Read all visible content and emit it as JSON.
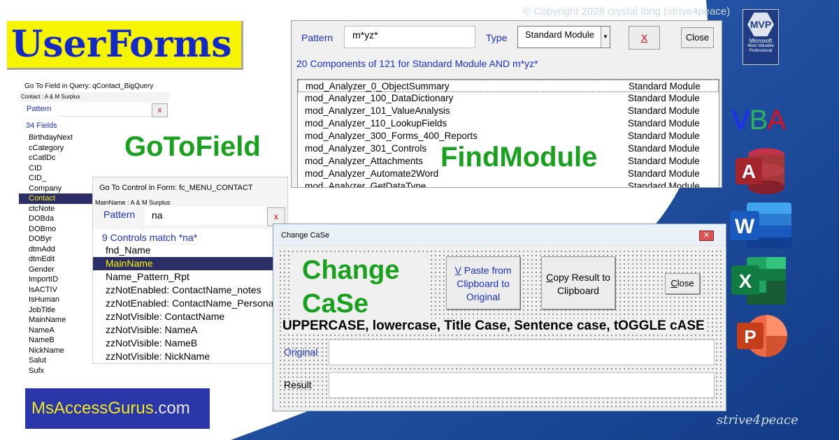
{
  "banner": {
    "title": "UserForms"
  },
  "copyright": "© Copyright 2026 crystal long (strive4peace)",
  "mvp": {
    "label": "MVP",
    "line1": "Microsoft",
    "line2": "Most Valuable",
    "line3": "Professional"
  },
  "vba": {
    "v": "V",
    "b": "B",
    "a": "A"
  },
  "labels": {
    "gotofield": "GoToField",
    "findmodule": "FindModule"
  },
  "goto_field": {
    "header": "Go To Field in Query: qContact_BigQuery",
    "subheader": "Contact : A & M Surplus",
    "pattern_label": "Pattern",
    "pattern_value": "",
    "clear_label": "x",
    "count": "34 Fields",
    "fields": [
      "BirthdayNext",
      "cCategory",
      "cCatlDc",
      "CID",
      "CID_",
      "Company",
      "Contact",
      "ctcNote",
      "DOBda",
      "DOBmo",
      "DOByr",
      "dtmAdd",
      "dtmEdit",
      "Gender",
      "ImportID",
      "IsACTIV",
      "IsHuman",
      "JobTitle",
      "MainName",
      "NameA",
      "NameB",
      "NickName",
      "Salut",
      "Sufx"
    ],
    "selected": "Contact"
  },
  "goto_control": {
    "header": "Go To Control in Form: fc_MENU_CONTACT",
    "subheader": "MainName : A & M Surplus",
    "pattern_label": "Pattern",
    "pattern_value": "na",
    "clear_label": "x",
    "count": "9 Controls match *na*",
    "controls": [
      "fnd_Name",
      "MainName",
      "Name_Pattern_Rpt",
      "zzNotEnabled: ContactName_notes",
      "zzNotEnabled: ContactName_Personal",
      "zzNotVisible: ContactName",
      "zzNotVisible: NameA",
      "zzNotVisible: NameB",
      "zzNotVisible: NickName"
    ],
    "selected": "MainName"
  },
  "find_module": {
    "pattern_label": "Pattern",
    "pattern_value": "m*yz*",
    "type_label": "Type",
    "type_value": "Standard Module",
    "clear_label": "X",
    "close_label": "Close",
    "count": "20 Components of 121 for Standard Module AND m*yz*",
    "rows": [
      {
        "name": "mod_Analyzer_0_ObjectSummary",
        "type": "Standard Module"
      },
      {
        "name": "mod_Analyzer_100_DataDictionary",
        "type": "Standard Module"
      },
      {
        "name": "mod_Analyzer_101_ValueAnalysis",
        "type": "Standard Module"
      },
      {
        "name": "mod_Analyzer_110_LookupFields",
        "type": "Standard Module"
      },
      {
        "name": "mod_Analyzer_300_Forms_400_Reports",
        "type": "Standard Module"
      },
      {
        "name": "mod_Analyzer_301_Controls",
        "type": "Standard Module"
      },
      {
        "name": "mod_Analyzer_Attachments",
        "type": "Standard Module"
      },
      {
        "name": "mod_Analyzer_Automate2Word",
        "type": "Standard Module"
      },
      {
        "name": "mod_Analyzer_GetDataType",
        "type": "Standard Module"
      }
    ]
  },
  "change_case": {
    "window_title": "Change CaSe",
    "close_x": "✕",
    "big_title": "Change\nCaSe",
    "paste_button": "V Paste from Clipboard to Original",
    "paste_hotkey": "V",
    "paste_rest": " Paste from Clipboard to Original",
    "copy_button": "Copy Result to Clipboard",
    "copy_hotkey": "C",
    "copy_rest": "opy Result to Clipboard",
    "close_button": "Close",
    "close_hotkey": "C",
    "close_rest": "lose",
    "modes": "UPPERCASE, lowercase, Title Case, Sentence case, tOGGLE cASE",
    "original_label": "Original",
    "original_value": "",
    "result_label": "Result",
    "result_value": ""
  },
  "logo": {
    "part1": "MsAccessGurus",
    "part2": ".com"
  },
  "signature": "strive4peace",
  "colors": {
    "accent_blue": "#1a2fd0",
    "green": "#17a11c",
    "banner_yellow": "#f7f400",
    "selection": "#2b2e67"
  },
  "icons": [
    "access-icon",
    "word-icon",
    "excel-icon",
    "powerpoint-icon"
  ]
}
